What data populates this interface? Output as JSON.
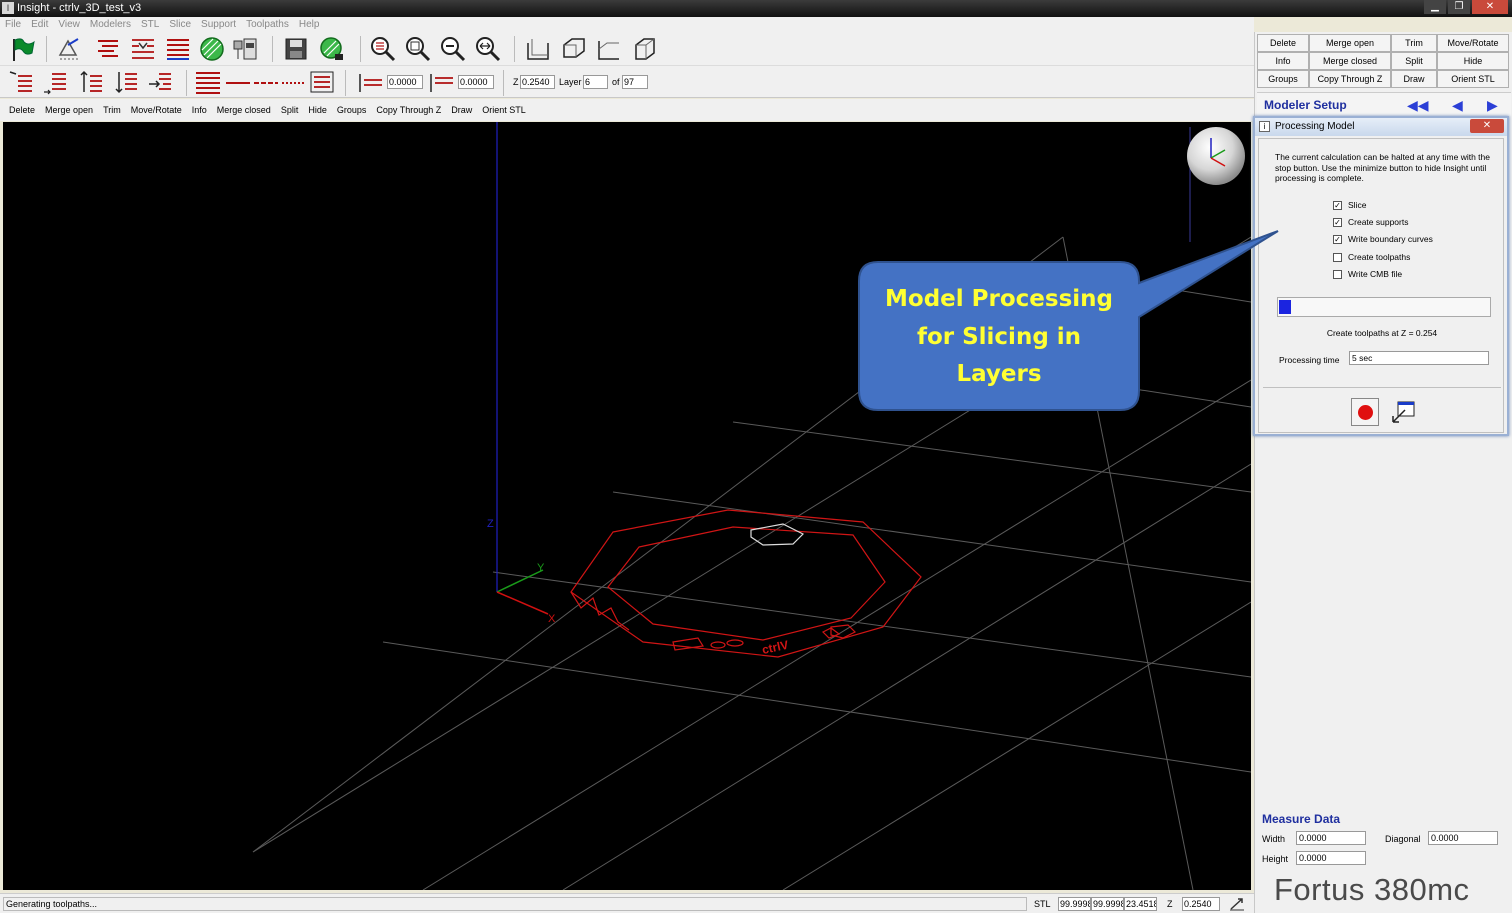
{
  "window": {
    "title": "Insight - ctrlv_3D_test_v3",
    "minimize": "▁",
    "restore": "❐",
    "close": "✕"
  },
  "menu": [
    "File",
    "Edit",
    "View",
    "Modelers",
    "STL",
    "Slice",
    "Support",
    "Toolpaths",
    "Help"
  ],
  "toolbar2": {
    "field1": "0.0000",
    "field2": "0.0000",
    "z_label": "Z",
    "z_value": "0.2540",
    "layer_label": "Layer",
    "layer_value": "6",
    "of_label": "of",
    "of_value": "97"
  },
  "commands": [
    "Delete",
    "Merge open",
    "Trim",
    "Move/Rotate",
    "Info",
    "Merge closed",
    "Split",
    "Hide",
    "Groups",
    "Copy Through Z",
    "Draw",
    "Orient STL"
  ],
  "right_panel": {
    "grid": [
      "Delete",
      "Merge open",
      "Trim",
      "Move/Rotate",
      "Info",
      "Merge closed",
      "Split",
      "Hide",
      "Groups",
      "Copy Through Z",
      "Draw",
      "Orient STL"
    ],
    "modeler_setup": "Modeler Setup"
  },
  "dialog": {
    "title": "Processing Model",
    "close": "✕",
    "description": "The current  calculation can be halted at any time with the stop button. Use  the minimize button to hide Insight until processing  is complete.",
    "options": [
      {
        "label": "Slice",
        "checked": true
      },
      {
        "label": "Create supports",
        "checked": true
      },
      {
        "label": "Write boundary curves",
        "checked": true
      },
      {
        "label": "Create toolpaths",
        "checked": false
      },
      {
        "label": "Write CMB file",
        "checked": false
      }
    ],
    "progress": 0.05,
    "status": "Create toolpaths at Z = 0.254",
    "processing_time_label": "Processing time",
    "processing_time_value": "5 sec"
  },
  "callout": {
    "line1": "Model Processing",
    "line2": "for Slicing in",
    "line3": "Layers",
    "fill": "#4472c4",
    "text_color": "#ffff33"
  },
  "measure": {
    "title": "Measure Data",
    "width_label": "Width",
    "width_value": "0.0000",
    "diagonal_label": "Diagonal",
    "diagonal_value": "0.0000",
    "height_label": "Height",
    "height_value": "0.0000"
  },
  "brand": "Fortus 380mc",
  "statusbar": {
    "message": "Generating toolpaths...",
    "mode": "STL",
    "v1": "99.9998",
    "v2": "99.9998",
    "v3": "23.4518",
    "z_label": "Z",
    "z_value": "0.2540"
  },
  "viewport": {
    "axis_z": "Z",
    "axis_y": "Y",
    "axis_x": "X",
    "model_text": "ctrlV"
  }
}
